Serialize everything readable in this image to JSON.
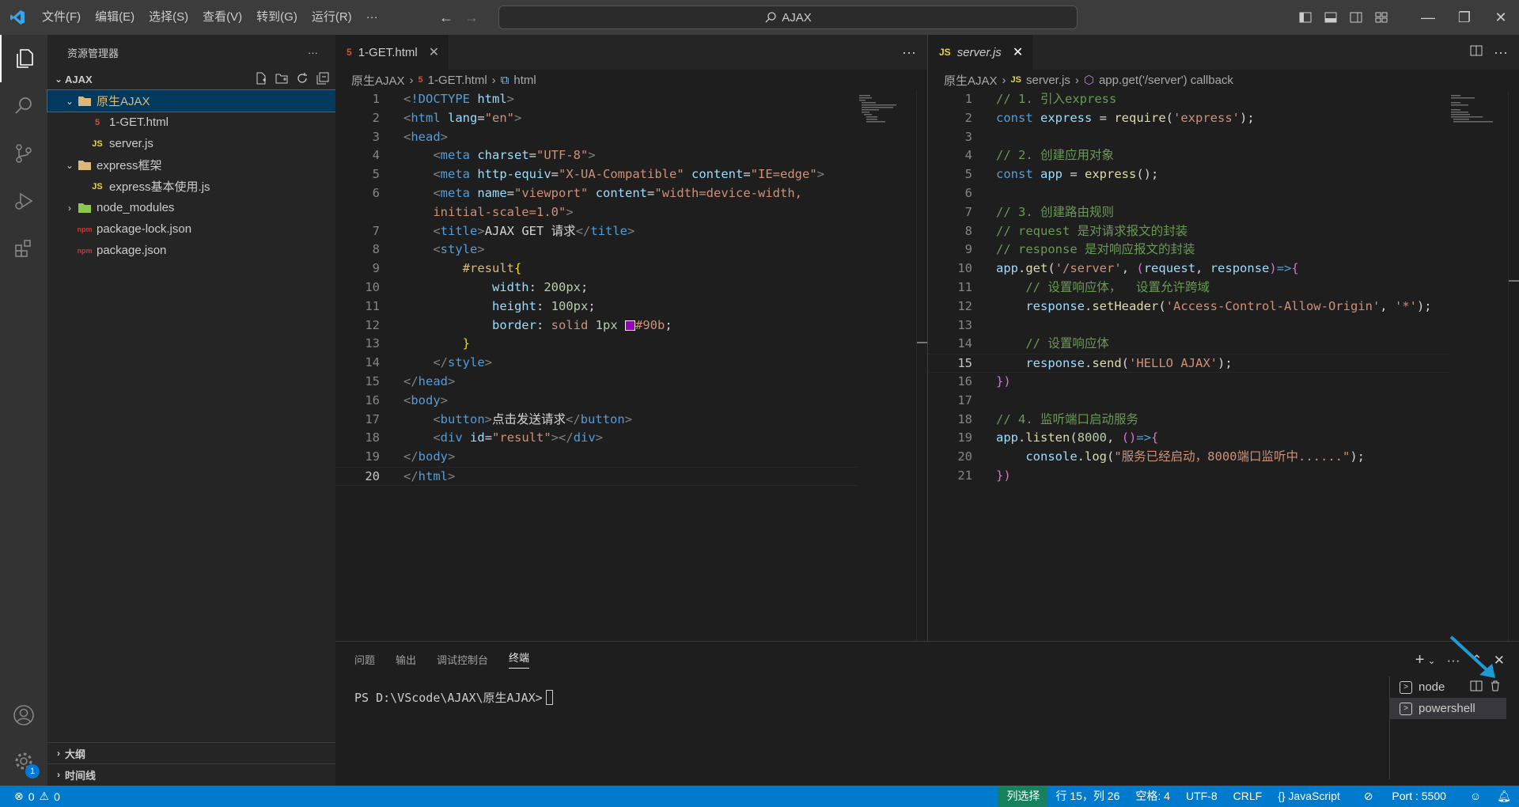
{
  "titlebar": {
    "menus": [
      "文件(F)",
      "编辑(E)",
      "选择(S)",
      "查看(V)",
      "转到(G)",
      "运行(R)",
      "···"
    ],
    "search": "AJAX"
  },
  "sidebar": {
    "header": "资源管理器",
    "section": "AJAX",
    "tree": [
      {
        "label": "原生AJAX",
        "type": "folder-open",
        "depth": 0,
        "selected": true
      },
      {
        "label": "1-GET.html",
        "type": "html",
        "depth": 1
      },
      {
        "label": "server.js",
        "type": "js",
        "depth": 1
      },
      {
        "label": "express框架",
        "type": "folder-open",
        "depth": 0
      },
      {
        "label": "express基本使用.js",
        "type": "js",
        "depth": 1
      },
      {
        "label": "node_modules",
        "type": "folder-closed",
        "depth": 0
      },
      {
        "label": "package-lock.json",
        "type": "json",
        "depth": 0
      },
      {
        "label": "package.json",
        "type": "json",
        "depth": 0
      }
    ],
    "outline": "大纲",
    "timeline": "时间线"
  },
  "editor_left": {
    "tab": "1-GET.html",
    "crumbs": [
      "原生AJAX",
      "1-GET.html",
      "html"
    ],
    "current_line": 20
  },
  "editor_right": {
    "tab": "server.js",
    "crumbs": [
      "原生AJAX",
      "server.js",
      "app.get('/server') callback"
    ],
    "current_line": 15
  },
  "panel": {
    "tabs": [
      "问题",
      "输出",
      "调试控制台",
      "终端"
    ],
    "active_tab": "终端",
    "prompt": "PS D:\\VScode\\AJAX\\原生AJAX> ",
    "terminals": [
      "node",
      "powershell"
    ]
  },
  "statusbar": {
    "errors": "0",
    "warnings": "0",
    "mode": "列选择",
    "position": "行 15，列 26",
    "spaces": "空格: 4",
    "encoding": "UTF-8",
    "eol": "CRLF",
    "language": "{} JavaScript",
    "port": "Port : 5500"
  },
  "activity_badge": "1",
  "colors": {
    "accent": "#007acc",
    "selection": "#04395e",
    "color_swatch": "#9900bb"
  }
}
